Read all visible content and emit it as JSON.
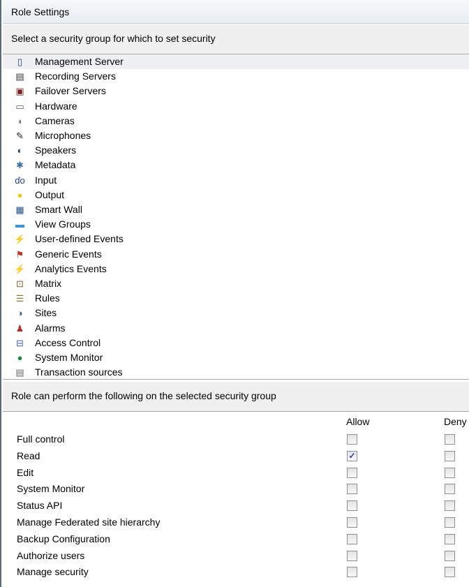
{
  "window": {
    "title": "Role Settings"
  },
  "group_section": {
    "prompt": "Select a security group for which to set security"
  },
  "security_groups": [
    {
      "label": "Management Server",
      "icon": "server-icon",
      "glyph": "▯",
      "color": "#1f3a8a",
      "selected": true
    },
    {
      "label": "Recording Servers",
      "icon": "recording-server-icon",
      "glyph": "▤",
      "color": "#333333"
    },
    {
      "label": "Failover Servers",
      "icon": "failover-server-icon",
      "glyph": "▣",
      "color": "#7a1f1f"
    },
    {
      "label": "Hardware",
      "icon": "hardware-icon",
      "glyph": "▭",
      "color": "#4a5a75"
    },
    {
      "label": "Cameras",
      "icon": "camera-icon",
      "glyph": "◖",
      "color": "#777777"
    },
    {
      "label": "Microphones",
      "icon": "microphone-icon",
      "glyph": "✎",
      "color": "#222222"
    },
    {
      "label": "Speakers",
      "icon": "speaker-icon",
      "glyph": "◐",
      "color": "#1a3d6b"
    },
    {
      "label": "Metadata",
      "icon": "metadata-icon",
      "glyph": "✱",
      "color": "#3b6f9e"
    },
    {
      "label": "Input",
      "icon": "input-icon",
      "glyph": "ɗo",
      "color": "#1f3a8a"
    },
    {
      "label": "Output",
      "icon": "lightbulb-icon",
      "glyph": "●",
      "color": "#f2c40f"
    },
    {
      "label": "Smart Wall",
      "icon": "smart-wall-icon",
      "glyph": "▦",
      "color": "#1f4f8a"
    },
    {
      "label": "View Groups",
      "icon": "folder-icon",
      "glyph": "▬",
      "color": "#3d8fd6"
    },
    {
      "label": "User-defined Events",
      "icon": "user-event-icon",
      "glyph": "⚡",
      "color": "#d49a00"
    },
    {
      "label": "Generic Events",
      "icon": "generic-event-icon",
      "glyph": "⚑",
      "color": "#c0392b"
    },
    {
      "label": "Analytics Events",
      "icon": "analytics-event-icon",
      "glyph": "⚡",
      "color": "#e67e22"
    },
    {
      "label": "Matrix",
      "icon": "matrix-icon",
      "glyph": "⊡",
      "color": "#8a5a1f"
    },
    {
      "label": "Rules",
      "icon": "rules-icon",
      "glyph": "☰",
      "color": "#8a7a3a"
    },
    {
      "label": "Sites",
      "icon": "sites-icon",
      "glyph": "◑",
      "color": "#3b5f8a"
    },
    {
      "label": "Alarms",
      "icon": "alarm-icon",
      "glyph": "♟",
      "color": "#b0302b"
    },
    {
      "label": "Access Control",
      "icon": "access-control-icon",
      "glyph": "⊟",
      "color": "#3b5fa8"
    },
    {
      "label": "System Monitor",
      "icon": "system-monitor-icon",
      "glyph": "●",
      "color": "#1f8a3a"
    },
    {
      "label": "Transaction sources",
      "icon": "transaction-source-icon",
      "glyph": "▤",
      "color": "#666666"
    }
  ],
  "permission_section": {
    "prompt": "Role can perform the following on the selected security group"
  },
  "columns": {
    "allow": "Allow",
    "deny": "Deny"
  },
  "permissions": [
    {
      "label": "Full control",
      "allow": false,
      "deny": false
    },
    {
      "label": "Read",
      "allow": true,
      "deny": false
    },
    {
      "label": "Edit",
      "allow": false,
      "deny": false
    },
    {
      "label": "System Monitor",
      "allow": false,
      "deny": false
    },
    {
      "label": "Status API",
      "allow": false,
      "deny": false
    },
    {
      "label": "Manage Federated site hierarchy",
      "allow": false,
      "deny": false
    },
    {
      "label": "Backup Configuration",
      "allow": false,
      "deny": false
    },
    {
      "label": "Authorize users",
      "allow": false,
      "deny": false
    },
    {
      "label": "Manage security",
      "allow": false,
      "deny": false
    }
  ],
  "check_glyph": "✓"
}
